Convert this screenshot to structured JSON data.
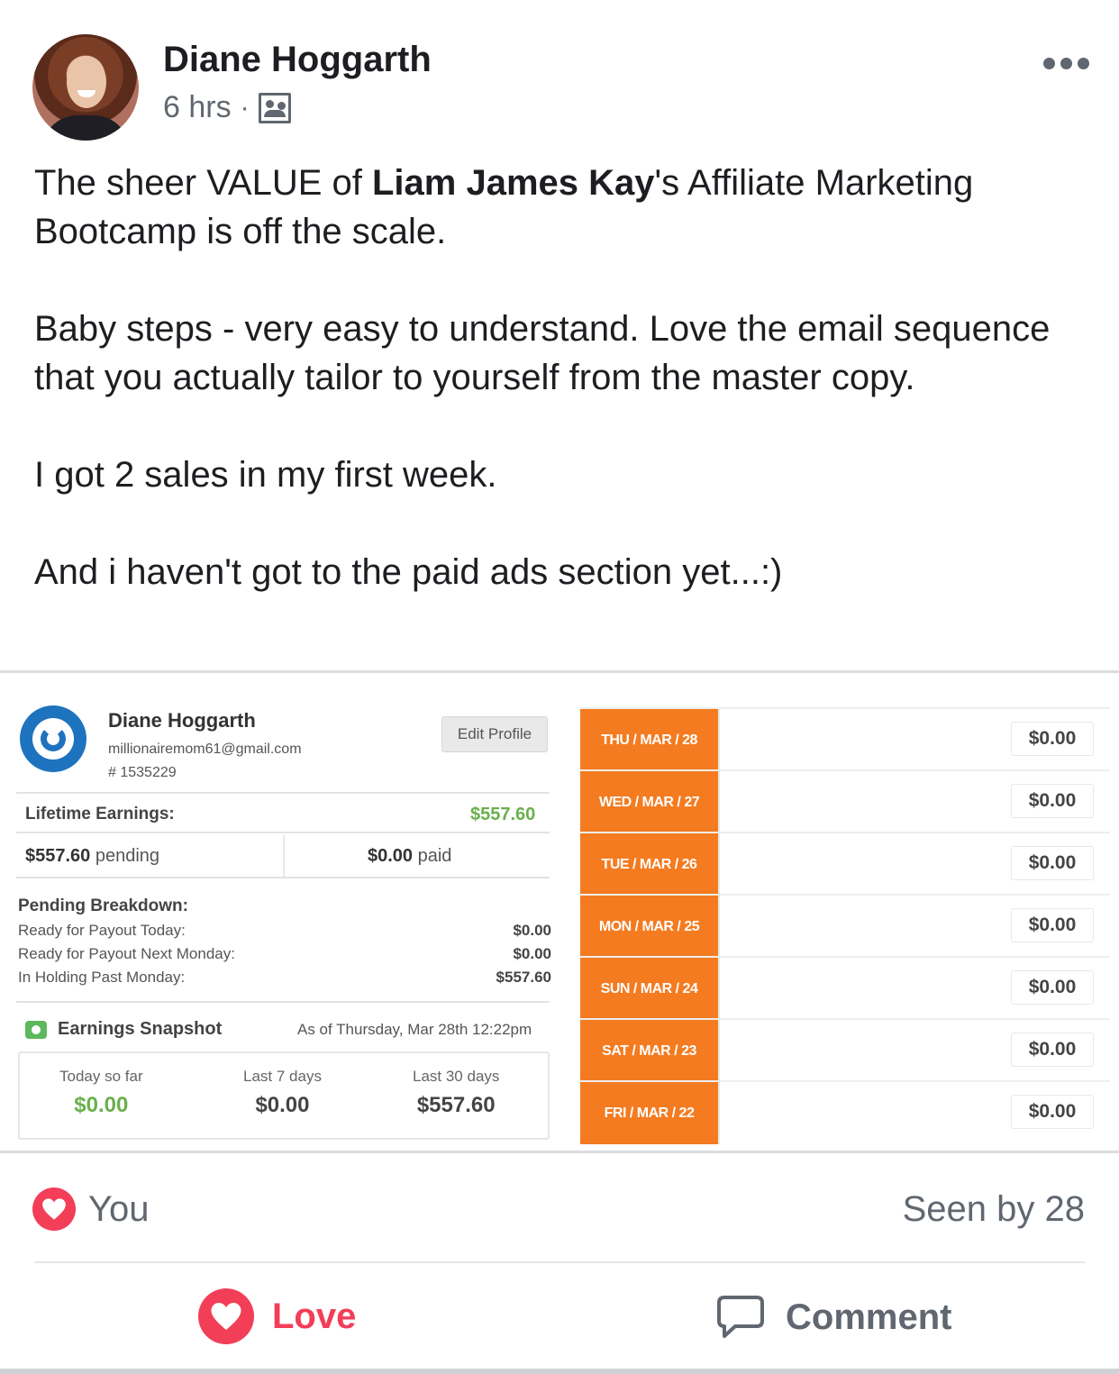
{
  "post": {
    "author": "Diane Hoggarth",
    "time": "6 hrs",
    "separator": "·",
    "audience_icon": "friends-icon",
    "more_icon": "more-dots-icon",
    "text": {
      "p1_a": "The sheer VALUE of ",
      "p1_bold": "Liam James Kay",
      "p1_b": "'s Affiliate Marketing Bootcamp is off the scale.",
      "p2": "Baby steps - very easy to understand. Love the email sequence that you actually tailor to yourself from the master copy.",
      "p3": "I got 2 sales in my first week.",
      "p4": "And i haven't got to the paid ads section yet...:)"
    }
  },
  "dashboard": {
    "user_name": "Diane Hoggarth",
    "email": "millionairemom61@gmail.com",
    "id": "# 1535229",
    "edit_profile": "Edit Profile",
    "lifetime_label": "Lifetime Earnings:",
    "lifetime_value": "$557.60",
    "pending_value": "$557.60",
    "pending_label": " pending",
    "paid_value": "$0.00",
    "paid_label": " paid",
    "pending_breakdown_title": "Pending Breakdown:",
    "breakdown": [
      {
        "label": "Ready for Payout Today:",
        "value": "$0.00"
      },
      {
        "label": "Ready for Payout Next Monday:",
        "value": "$0.00"
      },
      {
        "label": "In Holding Past Monday:",
        "value": "$557.60"
      }
    ],
    "snapshot_title": "Earnings Snapshot",
    "snapshot_asof": "As of Thursday, Mar 28th 12:22pm",
    "snapshot": [
      {
        "label": "Today so far",
        "value": "$0.00"
      },
      {
        "label": "Last 7 days",
        "value": "$0.00"
      },
      {
        "label": "Last 30 days",
        "value": "$557.60"
      }
    ],
    "days": [
      {
        "day": "THU / MAR / 28",
        "amount": "$0.00"
      },
      {
        "day": "WED / MAR / 27",
        "amount": "$0.00"
      },
      {
        "day": "TUE / MAR / 26",
        "amount": "$0.00"
      },
      {
        "day": "MON / MAR / 25",
        "amount": "$0.00"
      },
      {
        "day": "SUN / MAR / 24",
        "amount": "$0.00"
      },
      {
        "day": "SAT / MAR / 23",
        "amount": "$0.00"
      },
      {
        "day": "FRI / MAR / 22",
        "amount": "$0.00"
      }
    ],
    "accent_color": "#f47b20",
    "money_green": "#6ab04c"
  },
  "reactions": {
    "reactor": "You",
    "seen_by": "Seen by 28",
    "reaction_icon": "heart-icon"
  },
  "actions": {
    "love_label": "Love",
    "comment_label": "Comment",
    "love_color": "#f33e58"
  }
}
